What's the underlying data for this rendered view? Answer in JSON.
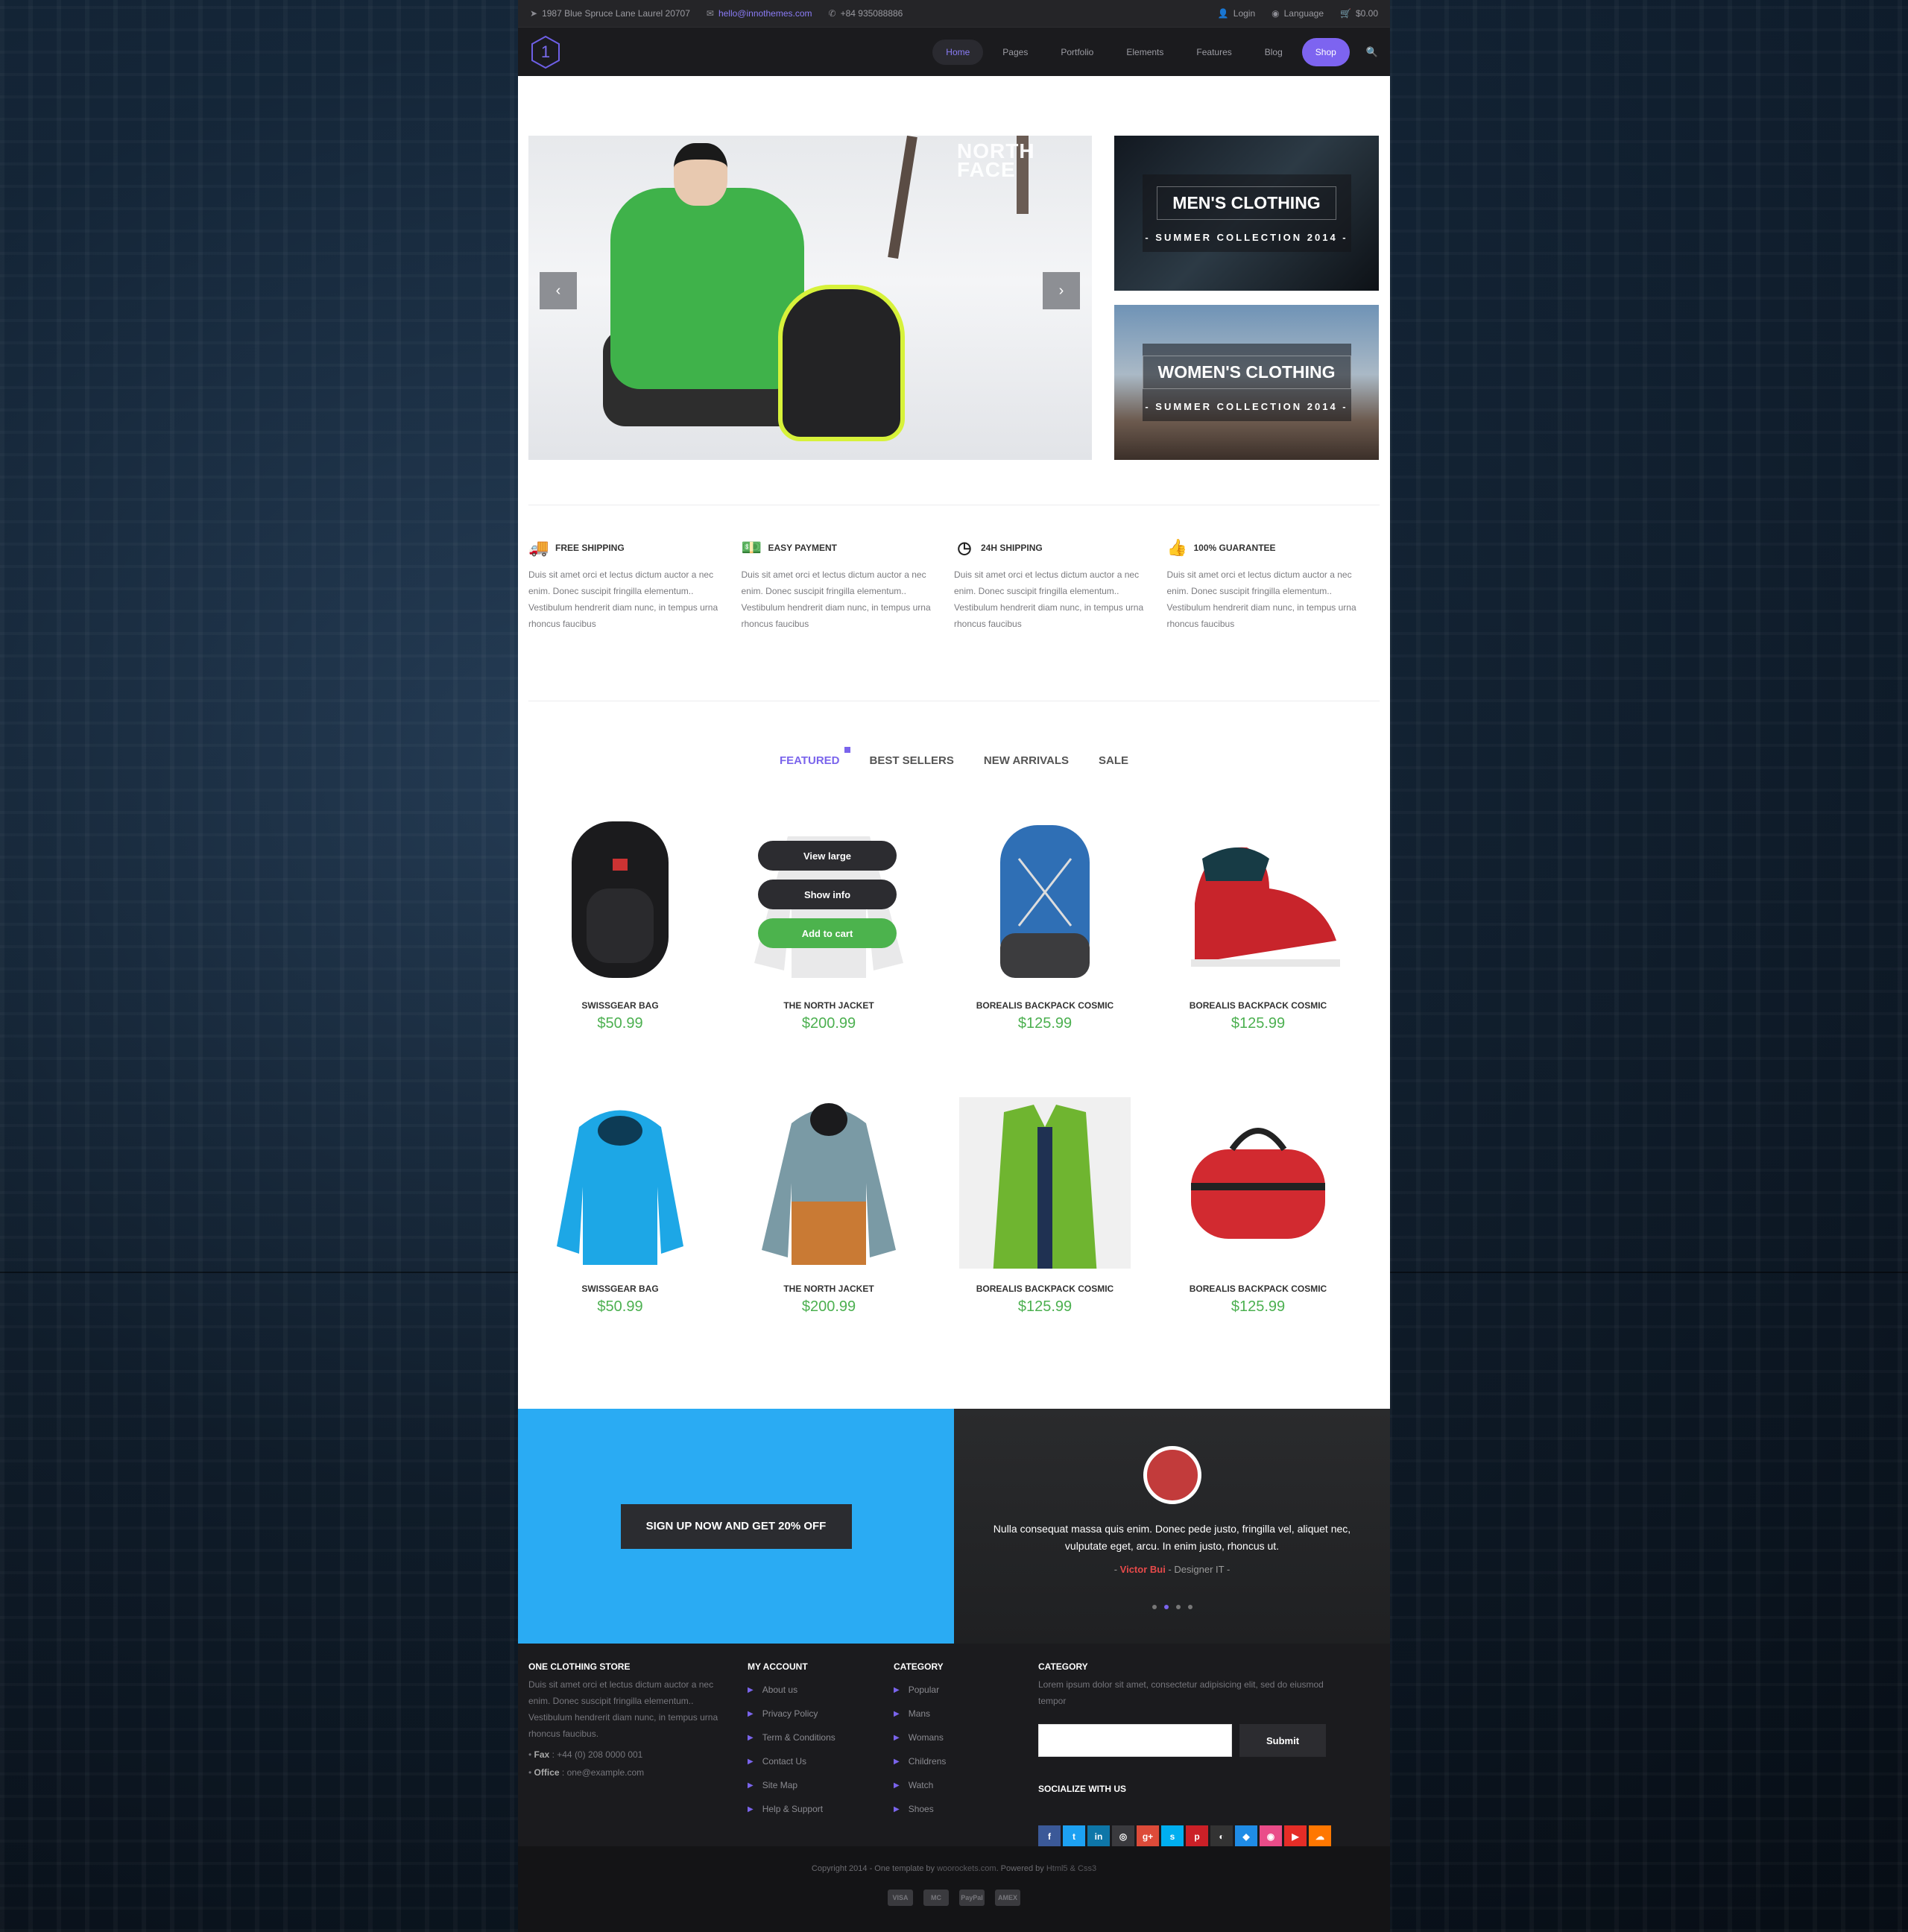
{
  "topbar": {
    "address": "1987 Blue Spruce Lane Laurel 20707",
    "email": "hello@innothemes.com",
    "phone": "+84 935088886",
    "login": "Login",
    "language": "Language",
    "cart": "$0.00"
  },
  "nav": {
    "logo": "1",
    "items": [
      "Home",
      "Pages",
      "Portfolio",
      "Elements",
      "Features",
      "Blog"
    ],
    "shop": "Shop"
  },
  "hero": {
    "brand": "NORTH FACE",
    "men": {
      "title": "MEN'S CLOTHING",
      "subtitle": "- SUMMER COLLECTION 2014 -"
    },
    "women": {
      "title": "WOMEN'S CLOTHING",
      "subtitle": "- SUMMER COLLECTION 2014 -"
    }
  },
  "features": [
    {
      "title": "FREE SHIPPING",
      "text": "Duis sit amet orci et lectus dictum auctor a nec enim. Donec suscipit fringilla elementum.. Vestibulum hendrerit diam nunc, in tempus urna rhoncus faucibus"
    },
    {
      "title": "EASY PAYMENT",
      "text": "Duis sit amet orci et lectus dictum auctor a nec enim. Donec suscipit fringilla elementum.. Vestibulum hendrerit diam nunc, in tempus urna rhoncus faucibus"
    },
    {
      "title": "24H SHIPPING",
      "text": "Duis sit amet orci et lectus dictum auctor a nec enim. Donec suscipit fringilla elementum.. Vestibulum hendrerit diam nunc, in tempus urna rhoncus faucibus"
    },
    {
      "title": "100% GUARANTEE",
      "text": "Duis sit amet orci et lectus dictum auctor a nec enim. Donec suscipit fringilla elementum.. Vestibulum hendrerit diam nunc, in tempus urna rhoncus faucibus"
    }
  ],
  "tabs": [
    "FEATURED",
    "BEST SELLERS",
    "NEW ARRIVALS",
    "SALE"
  ],
  "products": [
    {
      "name": "SWISSGEAR BAG",
      "price": "$50.99"
    },
    {
      "name": "THE NORTH JACKET",
      "price": "$200.99"
    },
    {
      "name": "BOREALIS BACKPACK COSMIC",
      "price": "$125.99"
    },
    {
      "name": "BOREALIS BACKPACK COSMIC",
      "price": "$125.99"
    },
    {
      "name": "SWISSGEAR BAG",
      "price": "$50.99"
    },
    {
      "name": "THE NORTH JACKET",
      "price": "$200.99"
    },
    {
      "name": "BOREALIS BACKPACK COSMIC",
      "price": "$125.99"
    },
    {
      "name": "BOREALIS BACKPACK COSMIC",
      "price": "$125.99"
    }
  ],
  "overlay": {
    "view": "View large",
    "info": "Show info",
    "cart": "Add to cart"
  },
  "cta": {
    "label": "SIGN UP NOW AND GET 20% OFF"
  },
  "testimonial": {
    "quote": "Nulla consequat massa quis enim. Donec pede justo, fringilla vel, aliquet nec, vulputate eget, arcu. In enim justo, rhoncus ut.",
    "name": "Victor Bui",
    "role": "Designer IT"
  },
  "footer": {
    "store": {
      "title": "ONE CLOTHING STORE",
      "text": "Duis sit amet orci et lectus dictum auctor a nec enim. Donec suscipit fringilla elementum.. Vestibulum hendrerit diam nunc, in tempus urna rhoncus faucibus.",
      "fax_label": "Fax",
      "fax": "+44 (0) 208 0000 001",
      "office_label": "Office",
      "office": "one@example.com"
    },
    "account": {
      "title": "MY ACCOUNT",
      "items": [
        "About us",
        "Privacy Policy",
        "Term & Conditions",
        "Contact Us",
        "Site Map",
        "Help & Support"
      ]
    },
    "category": {
      "title": "CATEGORY",
      "items": [
        "Popular",
        "Mans",
        "Womans",
        "Childrens",
        "Watch",
        "Shoes"
      ]
    },
    "newsletter": {
      "title": "CATEGORY",
      "text": "Lorem ipsum dolor sit amet, consectetur adipisicing elit, sed do eiusmod tempor",
      "submit": "Submit",
      "social_title": "SOCIALIZE WITH US"
    },
    "socials": [
      {
        "icon": "facebook-icon",
        "glyph": "f",
        "color": "#3b5998"
      },
      {
        "icon": "twitter-icon",
        "glyph": "t",
        "color": "#1da1f2"
      },
      {
        "icon": "linkedin-icon",
        "glyph": "in",
        "color": "#0e76a8"
      },
      {
        "icon": "instagram-icon",
        "glyph": "◎",
        "color": "#3a3a3e"
      },
      {
        "icon": "googleplus-icon",
        "glyph": "g+",
        "color": "#dd4b39"
      },
      {
        "icon": "skype-icon",
        "glyph": "s",
        "color": "#00aff0"
      },
      {
        "icon": "pinterest-icon",
        "glyph": "p",
        "color": "#cb2027"
      },
      {
        "icon": "github-icon",
        "glyph": "◐",
        "color": "#333333"
      },
      {
        "icon": "dropbox-icon",
        "glyph": "◆",
        "color": "#1f8ce6"
      },
      {
        "icon": "dribbble-icon",
        "glyph": "◉",
        "color": "#ea4c89"
      },
      {
        "icon": "youtube-icon",
        "glyph": "▶",
        "color": "#e52d27"
      },
      {
        "icon": "soundcloud-icon",
        "glyph": "☁",
        "color": "#ff7700"
      }
    ]
  },
  "copyright": {
    "prefix": "Copyright 2014 - One template by",
    "author": "woorockets.com",
    "middle": ". Powered by",
    "tech": "Html5 & Css3",
    "payments": [
      "VISA",
      "MC",
      "PayPal",
      "AMEX"
    ]
  }
}
